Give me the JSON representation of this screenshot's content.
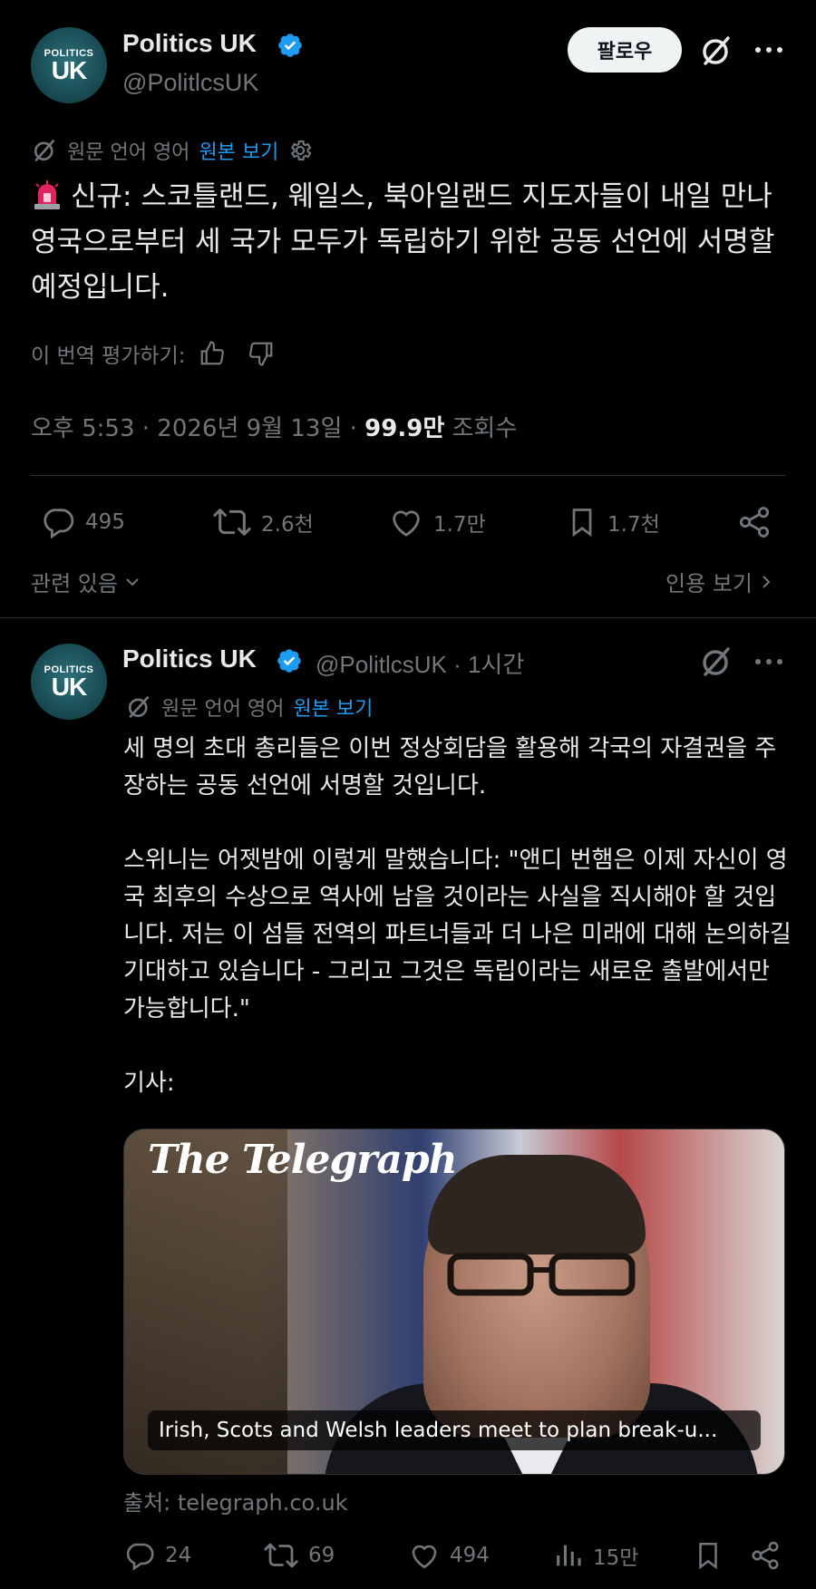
{
  "main_post": {
    "author": {
      "name": "Politics UK",
      "handle": "@PolitlcsUK",
      "avatar_small": "POLITICS",
      "avatar_big": "UK"
    },
    "follow_label": "팔로우",
    "translation": {
      "original_language": "원문 언어 영어",
      "view_original": "원본 보기"
    },
    "text": "신규: 스코틀랜드, 웨일스, 북아일랜드 지도자들이 내일 만나 영국으로부터 세 국가 모두가 독립하기 위한 공동 선언에 서명할 예정입니다.",
    "rate_translation": "이 번역 평가하기:",
    "timestamp": "오후 5:53 · 2026년 9월 13일 · ",
    "views_count": "99.9만",
    "views_label": " 조회수",
    "stats": {
      "replies": "495",
      "reposts": "2.6천",
      "likes": "1.7만",
      "bookmarks": "1.7천"
    },
    "related_label": "관련 있음",
    "quotes_label": "인용 보기"
  },
  "reply_post": {
    "author": {
      "name": "Politics UK",
      "handle": "@PolitlcsUK · 1시간",
      "avatar_small": "POLITICS",
      "avatar_big": "UK"
    },
    "translation": {
      "original_language": "원문 언어 영어",
      "view_original": "원본 보기"
    },
    "text": "세 명의 초대 총리들은 이번 정상회담을 활용해 각국의 자결권을 주장하는 공동 선언에 서명할 것입니다.\n\n스위니는 어젯밤에 이렇게 말했습니다: \"앤디 번햄은 이제 자신이 영국 최후의 수상으로 역사에 남을 것이라는 사실을 직시해야 할 것입니다. 저는 이 섬들 전역의 파트너들과 더 나은 미래에 대해 논의하길 기대하고 있습니다 - 그리고 그것은 독립이라는 새로운 출발에서만 가능합니다.\"\n\n기사:",
    "card": {
      "logo": "The Telegraph",
      "caption": "Irish, Scots and Welsh leaders meet to plan break-u..."
    },
    "source": "출처: telegraph.co.uk",
    "stats": {
      "replies": "24",
      "reposts": "69",
      "likes": "494",
      "views": "15만"
    }
  },
  "colors": {
    "background": "#000000",
    "text": "#e7e9ea",
    "muted": "#71767b",
    "link": "#1d9bf0",
    "verified": "#1d9bf0"
  }
}
